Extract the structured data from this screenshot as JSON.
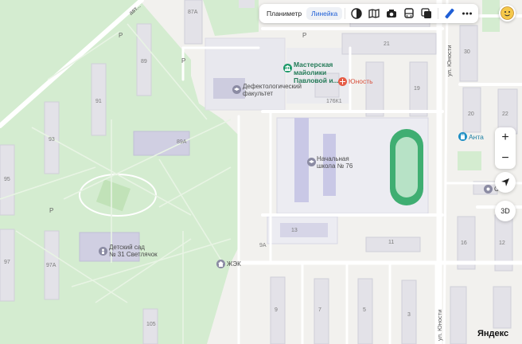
{
  "toolbar": {
    "planimeter": "Планиметр",
    "ruler": "Линейка",
    "icons": [
      "layers-icon",
      "panorama-icon",
      "camera-icon",
      "transport-icon",
      "overlay-icon",
      "ruler-icon",
      "more-icon"
    ]
  },
  "map_controls": {
    "zoom_in": "+",
    "zoom_out": "−",
    "mode_3d": "3D"
  },
  "pois": {
    "workshop": "Мастерская майолики Павловой и...",
    "workshop_line1": "Мастерская",
    "workshop_line2": "майолики",
    "workshop_line3": "Павловой и...",
    "shop": "Юность",
    "faculty_line1": "Дефектологический",
    "faculty_line2": "факультет",
    "school_line1": "Начальная",
    "school_line2": "школа № 76",
    "kindergarten_line1": "Детский сад",
    "kindergarten_line2": "№ 31 Светлячок",
    "housing_office": "ЖЭК",
    "anta": "Анта",
    "right_poi": "С..."
  },
  "streets": {
    "avenue_top": "авт...",
    "yunosti_top": "ул. Юности",
    "yunosti_bottom": "ул. Юности"
  },
  "buildings": [
    "87А",
    "89",
    "91",
    "93",
    "95",
    "97",
    "97А",
    "89А",
    "21",
    "19",
    "30",
    "20",
    "22",
    "176К1",
    "13",
    "11",
    "16",
    "12",
    "9А",
    "9",
    "7",
    "5",
    "3",
    "105",
    "P"
  ],
  "parking_label": "P",
  "brand": "Яндекс",
  "colors": {
    "park": "#d4ecd0",
    "park_dark": "#c5e4bf",
    "building": "#e3e2e8",
    "building_stroke": "#cfcfd8",
    "road": "#ffffff",
    "school": "#e9e9f2",
    "school_building": "#c9c8e6",
    "stadium": "#2fa36b",
    "workshop_pin": "#1e9a6a",
    "shop_pin": "#e55b45",
    "anta_pin": "#1f8fc4",
    "accent": "#1f5fd6"
  }
}
